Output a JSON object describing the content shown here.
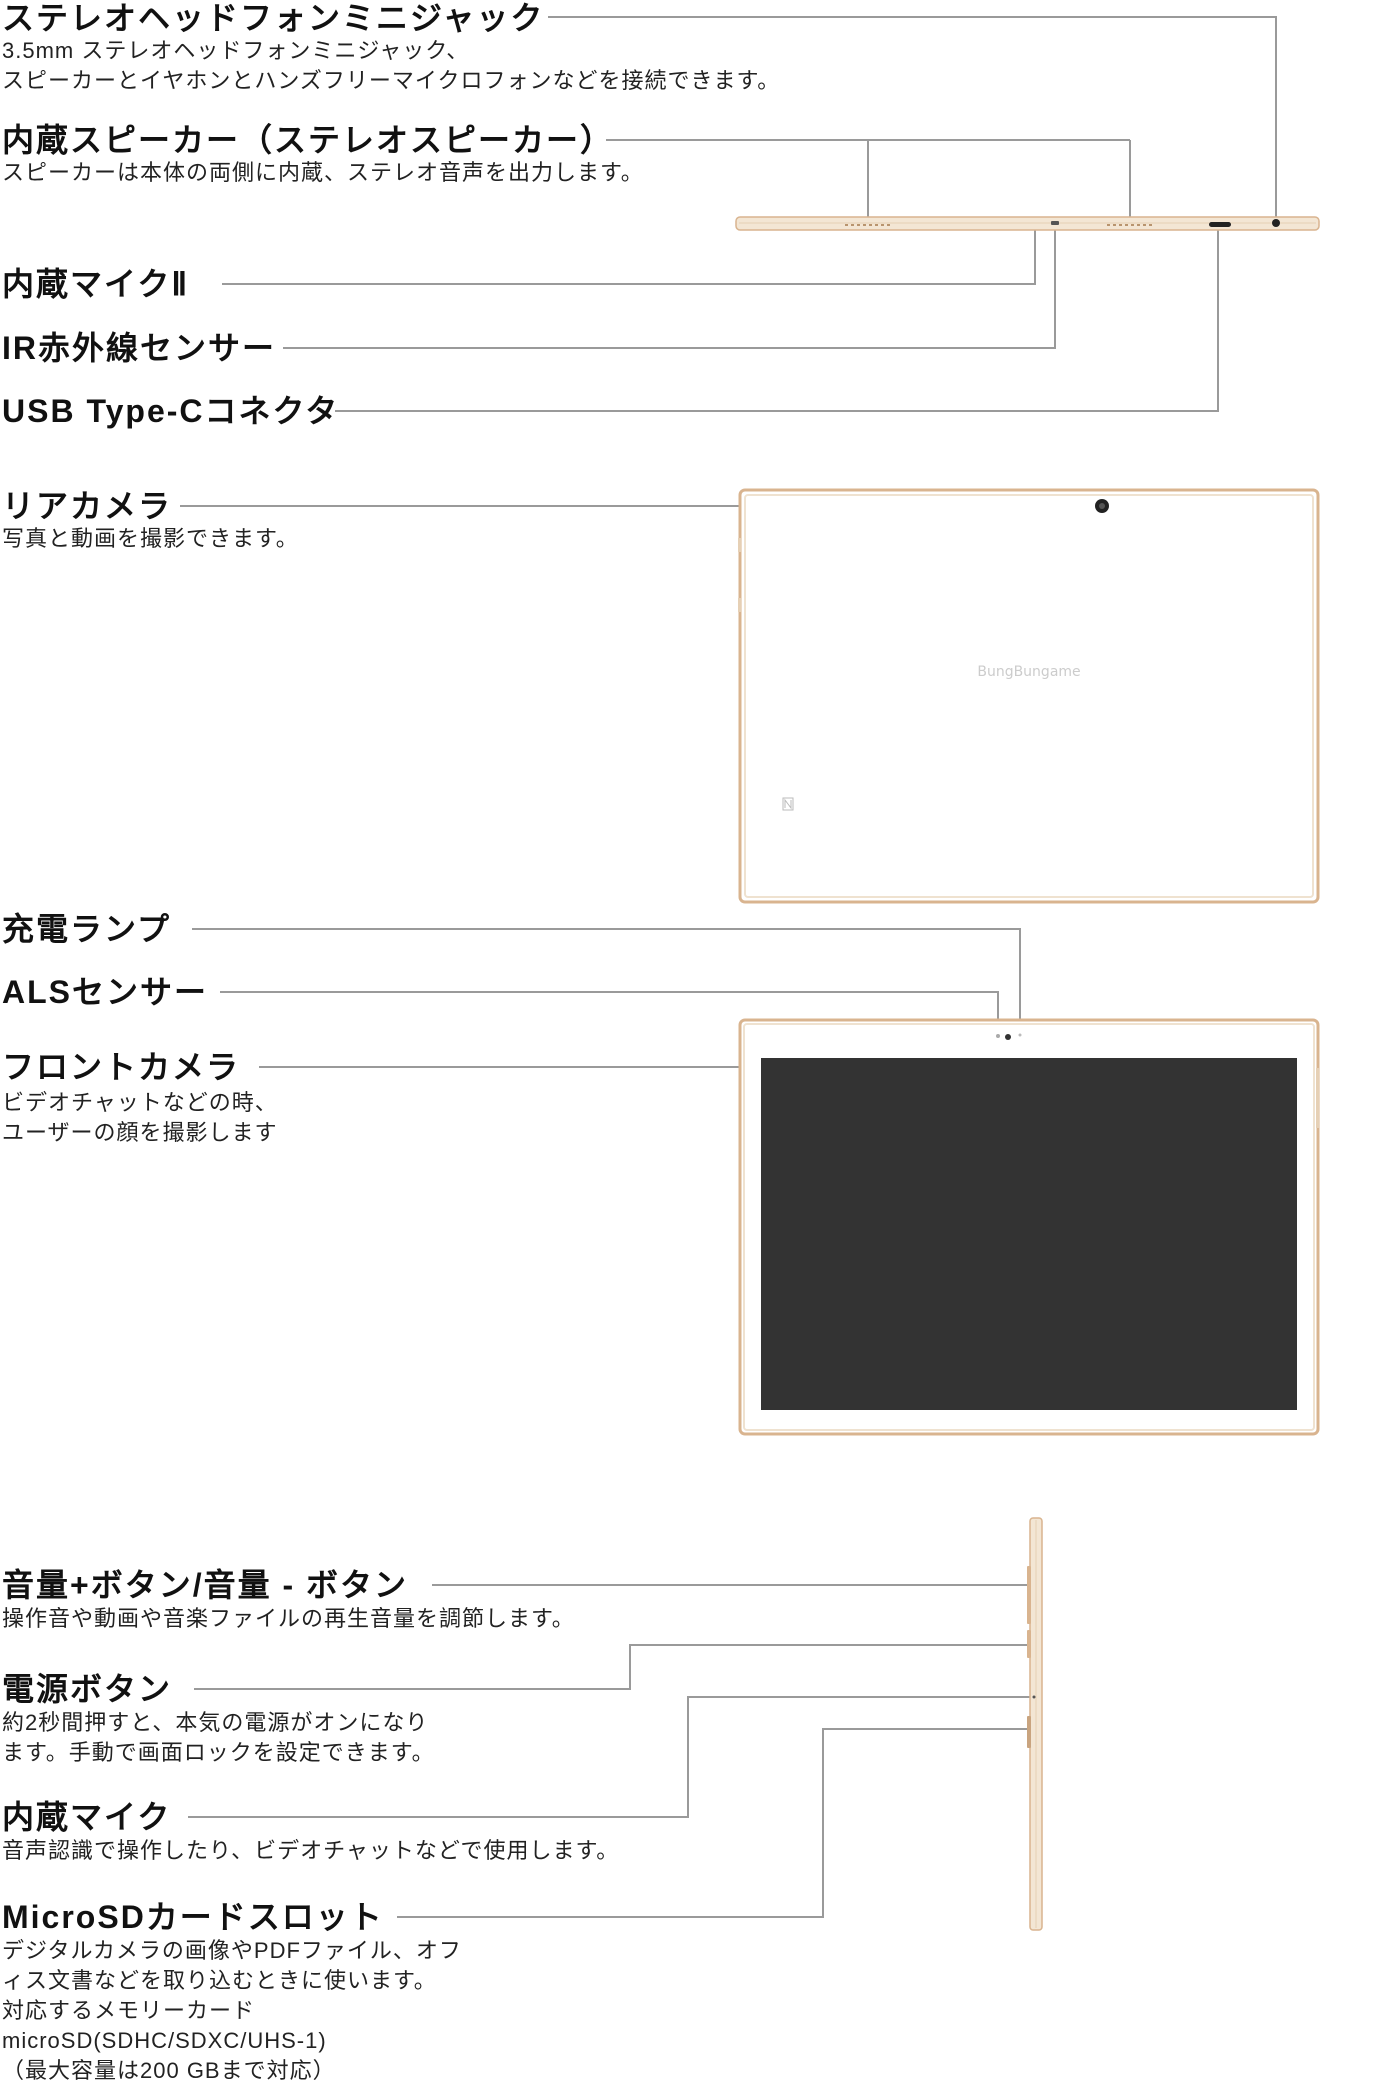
{
  "sections": {
    "headphone_jack": {
      "label": "ステレオヘッドフォンミニジャック",
      "desc": [
        "3.5mm ステレオヘッドフォンミニジャック、",
        "スピーカーとイヤホンとハンズフリーマイクロフォンなどを接続できます。"
      ]
    },
    "speaker": {
      "label": "内蔵スピーカー（ステレオスピーカー）",
      "desc": [
        "スピーカーは本体の両側に内蔵、ステレオ音声を出力します。"
      ]
    },
    "mic2": {
      "label": "内蔵マイクⅡ"
    },
    "ir_sensor": {
      "label": "IR赤外線センサー"
    },
    "usb_c": {
      "label": "USB Type-Cコネクタ"
    },
    "rear_camera": {
      "label": "リアカメラ",
      "desc": [
        "写真と動画を撮影できます。"
      ]
    },
    "charge_lamp": {
      "label": "充電ランプ"
    },
    "als_sensor": {
      "label": "ALSセンサー"
    },
    "front_camera": {
      "label": "フロントカメラ",
      "desc": [
        "ビデオチャットなどの時、",
        "ユーザーの顔を撮影します"
      ]
    },
    "volume": {
      "label": "音量+ボタン/音量 - ボタン",
      "desc": [
        "操作音や動画や音楽ファイルの再生音量を調節します。"
      ]
    },
    "power": {
      "label": "電源ボタン",
      "desc": [
        "約2秒間押すと、本気の電源がオンになり",
        "ます。手動で画面ロックを設定できます。"
      ]
    },
    "mic": {
      "label": "内蔵マイク",
      "desc": [
        "音声認識で操作したり、ビデオチャットなどで使用します。"
      ]
    },
    "microsd": {
      "label": "MicroSDカードスロット",
      "desc": [
        "デジタルカメラの画像やPDFファイル、オフ",
        "ィス文書などを取り込むときに使います。",
        "対応するメモリーカード",
        "microSD(SDHC/SDXC/UHS-1)",
        "（最大容量は200 GBまで対応）"
      ]
    }
  },
  "device": {
    "brand": "BungBungame"
  },
  "colors": {
    "leader_line": "#9a9a9a",
    "gold_frame": "#d9b48f",
    "screen": "#333333"
  }
}
